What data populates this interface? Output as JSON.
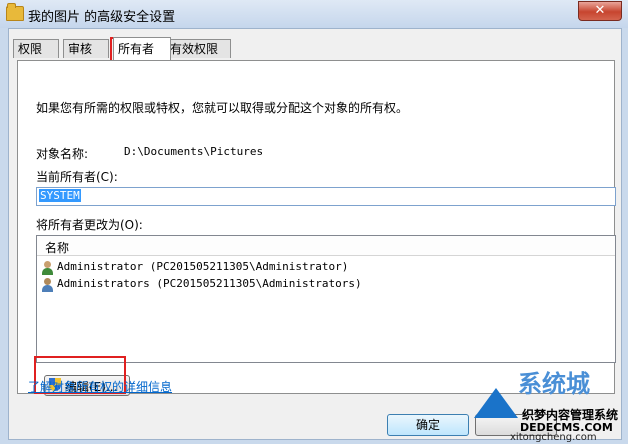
{
  "window": {
    "title": "我的图片 的高级安全设置",
    "close_label": "✕"
  },
  "tabs": [
    {
      "label": "权限",
      "active": false
    },
    {
      "label": "审核",
      "active": false
    },
    {
      "label": "所有者",
      "active": true
    },
    {
      "label": "有效权限",
      "active": false
    }
  ],
  "owner_page": {
    "description": "如果您有所需的权限或特权，您就可以取得或分配这个对象的所有权。",
    "object_name_label": "对象名称:",
    "object_name_value": "D:\\Documents\\Pictures",
    "current_owner_label": "当前所有者(C):",
    "current_owner_value": "SYSTEM",
    "change_owner_label": "将所有者更改为(O):",
    "list_header": "名称",
    "owners": [
      {
        "name": "Administrator (PC201505211305\\Administrator)",
        "icon": "user-icon"
      },
      {
        "name": "Administrators (PC201505211305\\Administrators)",
        "icon": "users-group-icon"
      }
    ],
    "edit_button": "编辑(E)...",
    "edit_button_icon": "uac-shield-icon",
    "learn_more_link": "了解对象所有权的详细信息"
  },
  "buttons": {
    "ok": "确定"
  },
  "watermark": {
    "line1": "系统城",
    "line2": "织梦内容管理系统",
    "line3": "DEDECMS.COM",
    "line4": "xitongcheng.com"
  },
  "colors": {
    "highlight": "#e02020",
    "selection": "#3399ff",
    "link": "#0066cc"
  }
}
